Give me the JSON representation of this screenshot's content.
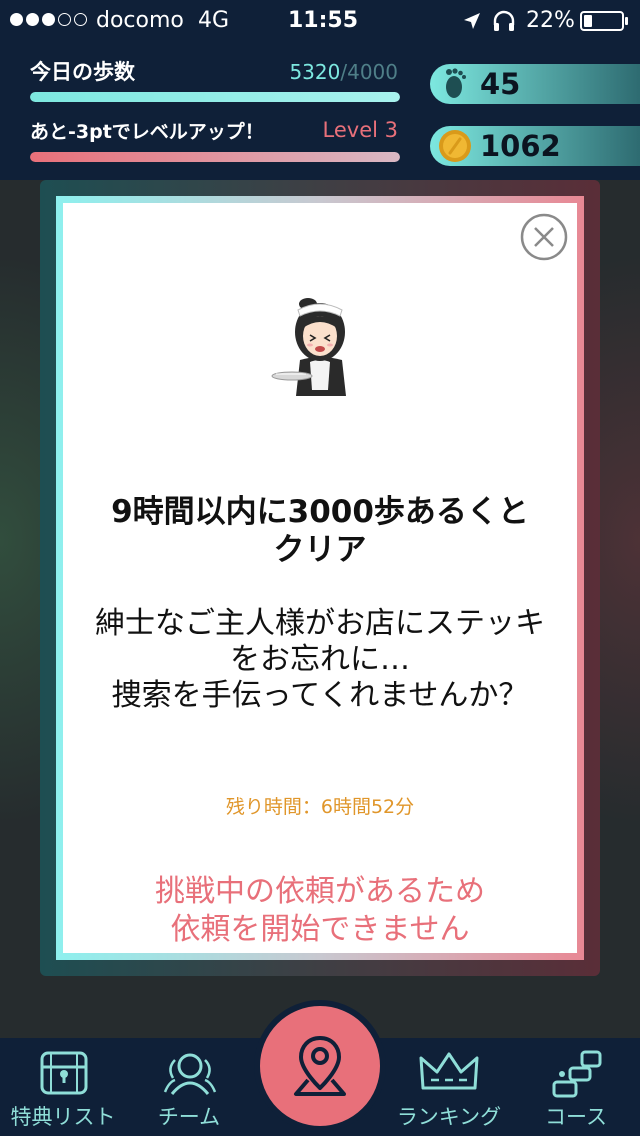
{
  "status_bar": {
    "carrier": "docomo",
    "network": "4G",
    "time": "11:55",
    "battery": "22%",
    "signal_strength": 3,
    "signal_max": 5,
    "battery_level": 0.22
  },
  "header": {
    "today_steps_label": "今日の歩数",
    "steps_current": "5320",
    "steps_goal": "/4000",
    "steps_progress": 1.0,
    "level_message": "あと-3ptでレベルアップ！",
    "level": "Level 3",
    "level_progress": 1.0,
    "footprint_count": "45",
    "coin_count": "1062"
  },
  "modal": {
    "title": "9時間以内に3000歩あるくとクリア",
    "description": "紳士なご主人様がお店にステッキをお忘れに…\n捜索を手伝ってくれませんか？",
    "time_remaining": "残り時間：6時間52分",
    "warning": "挑戦中の依頼があるため\n依頼を開始できません"
  },
  "tabs": [
    {
      "label": "特典リスト",
      "icon": "treasure-chest-icon"
    },
    {
      "label": "チーム",
      "icon": "team-icon"
    },
    {
      "label": "ランキング",
      "icon": "crown-icon"
    },
    {
      "label": "コース",
      "icon": "course-icon"
    }
  ],
  "center_button": {
    "icon": "map-pin-icon"
  },
  "colors": {
    "header_bg": "#0f2038",
    "accent_teal": "#7de8e0",
    "accent_pink": "#e8707a",
    "time_orange": "#e0962a"
  }
}
